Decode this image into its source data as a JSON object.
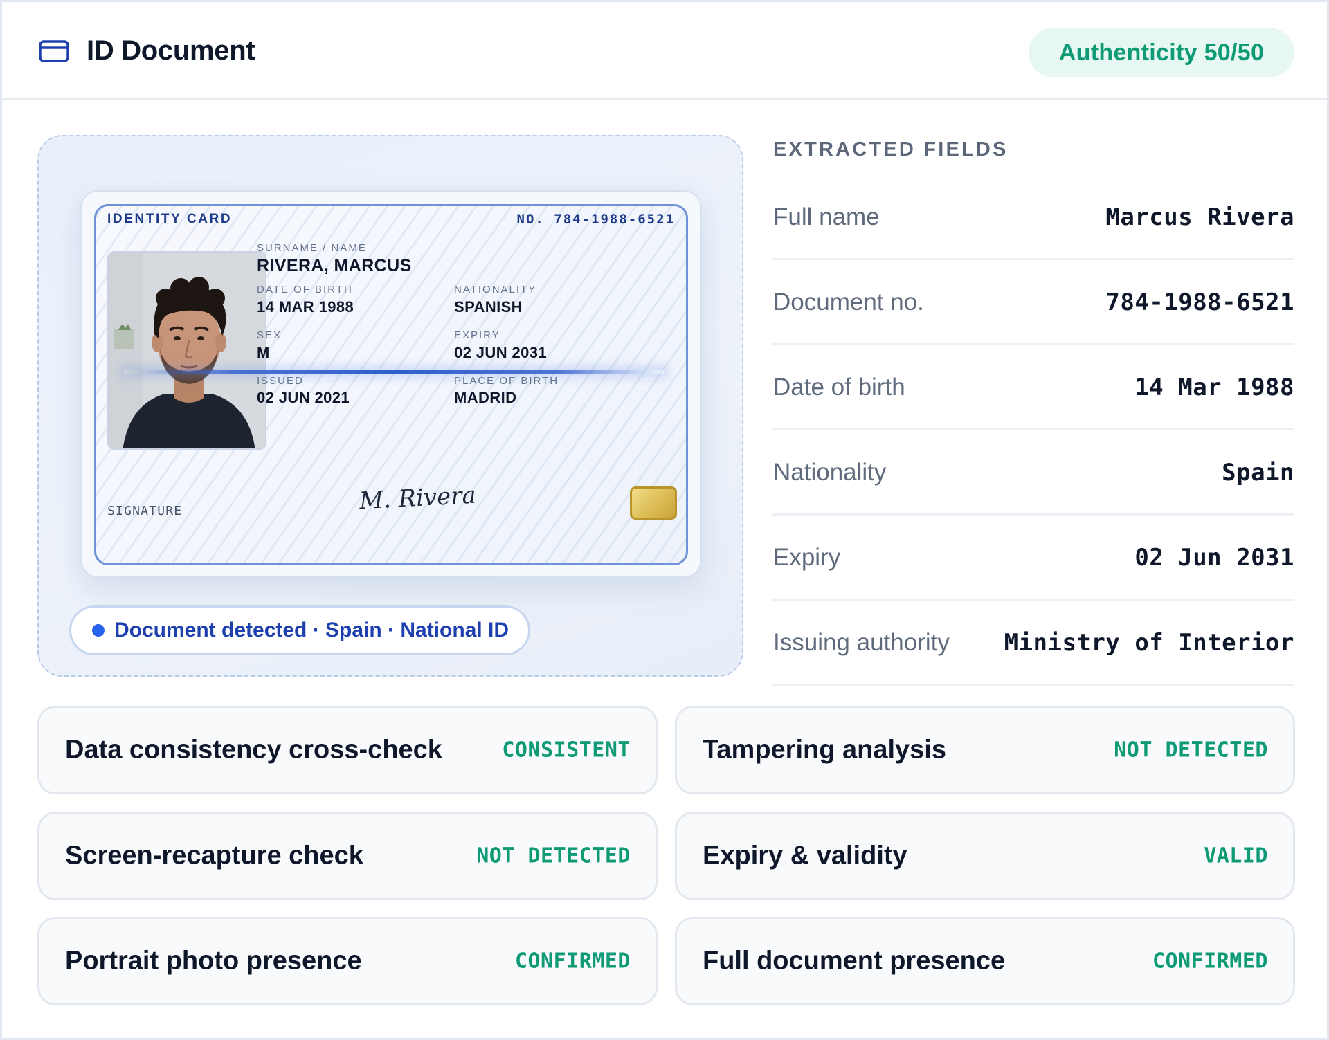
{
  "header": {
    "icon": "id-card-icon",
    "title": "ID Document",
    "authenticity_badge": "Authenticity 50/50"
  },
  "document": {
    "card": {
      "heading": "IDENTITY CARD",
      "number": "NO. 784-1988-6521",
      "fields": [
        {
          "label": "SURNAME / NAME",
          "value": "RIVERA, MARCUS"
        },
        {
          "label": "DATE OF BIRTH",
          "value": "14 MAR 1988"
        },
        {
          "label": "NATIONALITY",
          "value": "SPANISH"
        },
        {
          "label": "SEX",
          "value": "M"
        },
        {
          "label": "EXPIRY",
          "value": "02 JUN 2031"
        },
        {
          "label": "ISSUED",
          "value": "02 JUN 2021"
        },
        {
          "label": "PLACE OF BIRTH",
          "value": "MADRID"
        }
      ],
      "signature_label": "SIGNATURE",
      "signature": "M. Rivera"
    },
    "detection": "Document detected · Spain · National ID"
  },
  "extracted": {
    "title": "EXTRACTED FIELDS",
    "rows": [
      {
        "label": "Full name",
        "value": "Marcus Rivera"
      },
      {
        "label": "Document no.",
        "value": "784-1988-6521"
      },
      {
        "label": "Date of birth",
        "value": "14 Mar 1988"
      },
      {
        "label": "Nationality",
        "value": "Spain"
      },
      {
        "label": "Expiry",
        "value": "02 Jun 2031"
      },
      {
        "label": "Issuing authority",
        "value": "Ministry of Interior"
      }
    ]
  },
  "checks": [
    {
      "label": "Data consistency cross-check",
      "status": "CONSISTENT"
    },
    {
      "label": "Tampering analysis",
      "status": "NOT DETECTED"
    },
    {
      "label": "Screen-recapture check",
      "status": "NOT DETECTED"
    },
    {
      "label": "Expiry & validity",
      "status": "VALID"
    },
    {
      "label": "Portrait photo presence",
      "status": "CONFIRMED"
    },
    {
      "label": "Full document presence",
      "status": "CONFIRMED"
    }
  ],
  "colors": {
    "accent": "#1e40af",
    "success": "#0f9a76",
    "success_bg": "#e7f7f1"
  }
}
